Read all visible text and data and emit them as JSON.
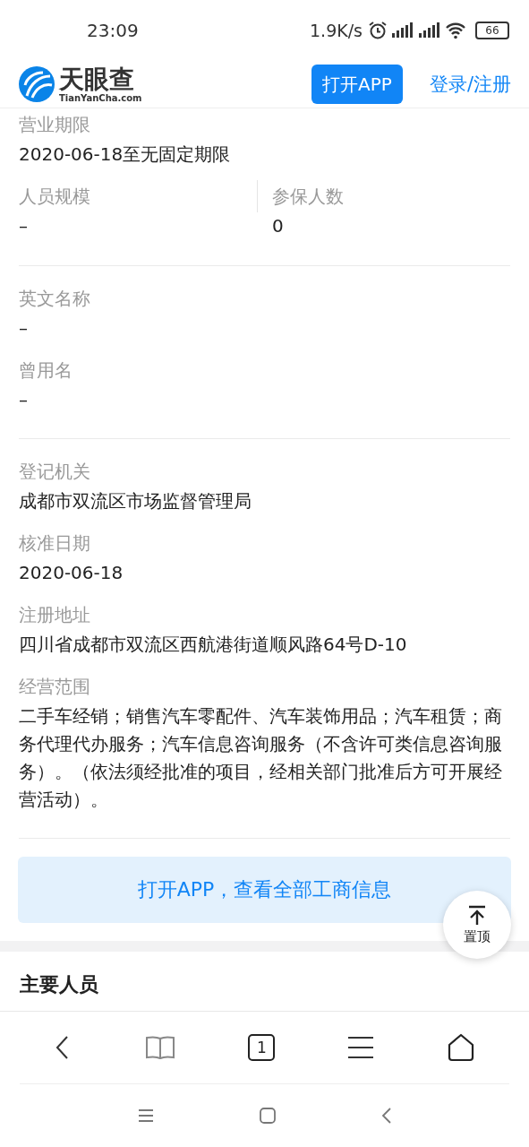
{
  "status_bar": {
    "time": "23:09",
    "net_speed": "1.9K/s",
    "battery": "66"
  },
  "header": {
    "logo_text": "天眼查",
    "logo_sub": "TianYanCha.com",
    "open_button": "打开APP",
    "login_link": "登录/注册"
  },
  "info_groups": [
    [
      {
        "kind": "field",
        "label": "营业期限",
        "value": "2020-06-18至无固定期限"
      },
      {
        "kind": "pair",
        "fields": [
          {
            "label": "人员规模",
            "value": "–"
          },
          {
            "label": "参保人数",
            "value": "0"
          }
        ]
      }
    ],
    [
      {
        "kind": "field",
        "label": "英文名称",
        "value": "–"
      },
      {
        "kind": "field",
        "label": "曾用名",
        "value": "–"
      }
    ],
    [
      {
        "kind": "field",
        "label": "登记机关",
        "value": "成都市双流区市场监督管理局"
      },
      {
        "kind": "field",
        "label": "核准日期",
        "value": "2020-06-18"
      },
      {
        "kind": "field",
        "label": "注册地址",
        "value": "四川省成都市双流区西航港街道顺风路64号D-10"
      },
      {
        "kind": "field",
        "label": "经营范围",
        "value": "二手车经销；销售汽车零配件、汽车装饰用品；汽车租赁；商务代理代办服务；汽车信息咨询服务（不含许可类信息咨询服务）。（依法须经批准的项目，经相关部门批准后方可开展经营活动）。"
      }
    ]
  ],
  "cta_banner": "打开APP，查看全部工商信息",
  "top_button": "置顶",
  "section_title": "主要人员",
  "browser_toolbar": {
    "tab_count": "1"
  }
}
